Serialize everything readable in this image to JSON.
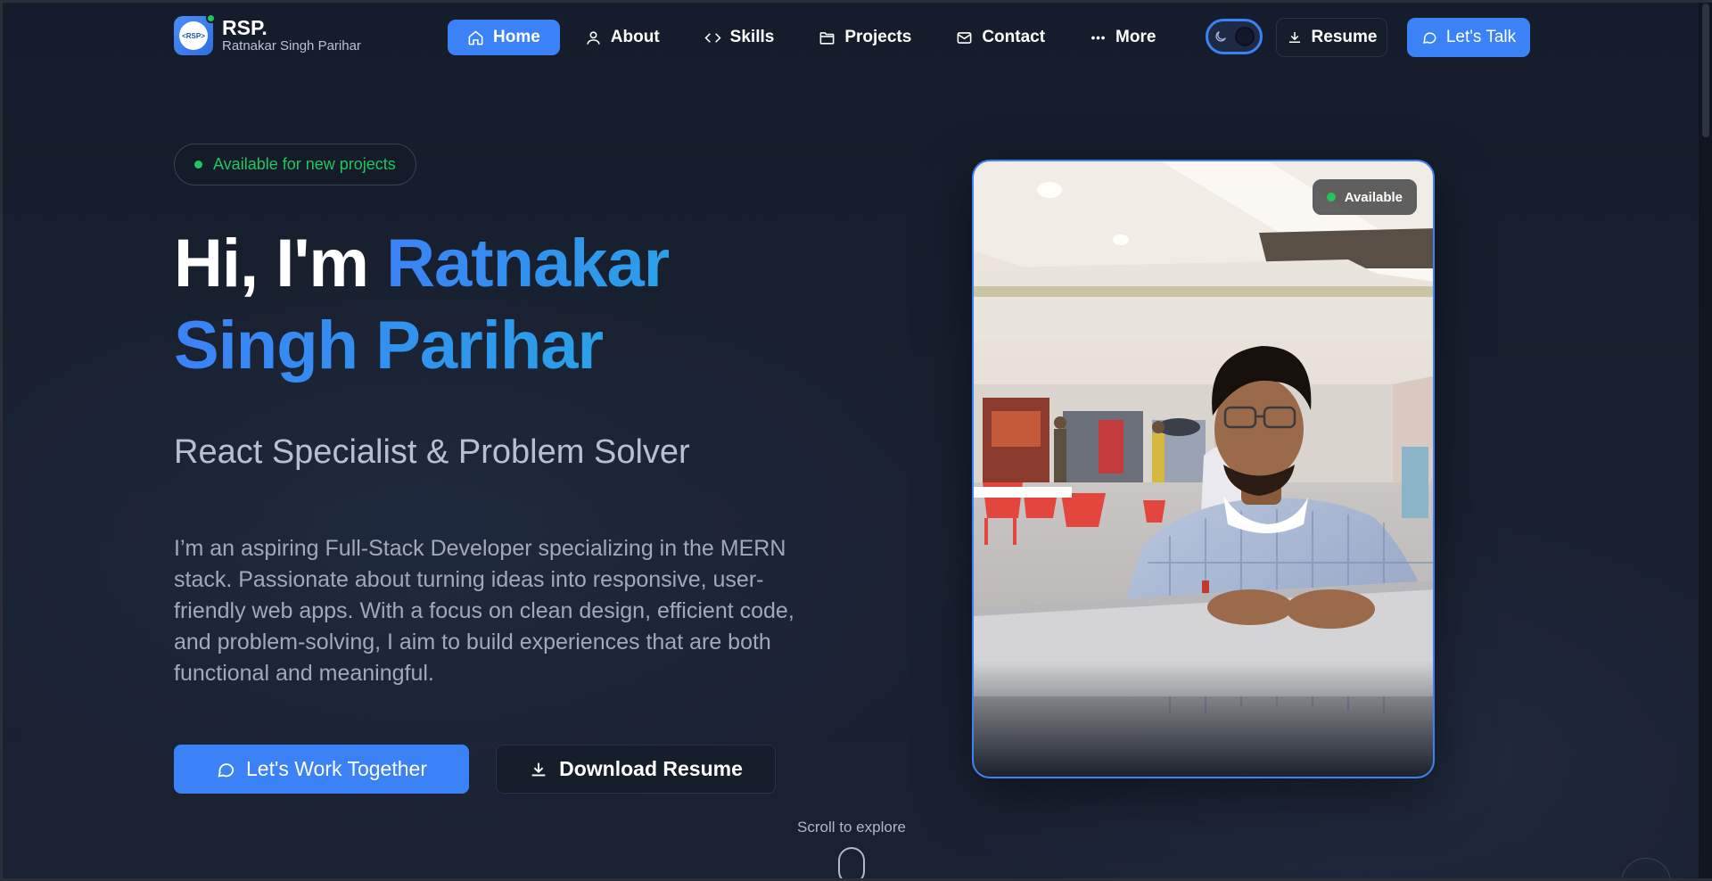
{
  "brand": {
    "logo_text": "<RSP>",
    "title": "RSP.",
    "subtitle": "Ratnakar Singh Parihar"
  },
  "nav": {
    "items": [
      {
        "label": "Home",
        "icon": "home-icon",
        "active": true
      },
      {
        "label": "About",
        "icon": "user-icon",
        "active": false
      },
      {
        "label": "Skills",
        "icon": "code-icon",
        "active": false
      },
      {
        "label": "Projects",
        "icon": "folder-icon",
        "active": false
      },
      {
        "label": "Contact",
        "icon": "mail-icon",
        "active": false
      },
      {
        "label": "More",
        "icon": "more-dots-icon",
        "active": false
      }
    ],
    "theme_toggle": {
      "icon": "moon-icon",
      "state": "dark"
    },
    "resume_label": "Resume",
    "talk_label": "Let's Talk"
  },
  "hero": {
    "availability": "Available for new projects",
    "greeting": "Hi, I'm ",
    "name_line1": "Ratnakar",
    "name_line2": "Singh Parihar",
    "tagline": "React Specialist & Problem Solver",
    "intro": "I’m an aspiring Full-Stack Developer specializing in the MERN stack. Passionate about turning ideas into responsive, user-friendly web apps. With a focus on clean design, efficient code, and problem-solving, I aim to build experiences that are both functional and meaningful.",
    "cta_primary": "Let's Work Together",
    "cta_secondary": "Download Resume",
    "scroll_hint": "Scroll to explore"
  },
  "photo_card": {
    "badge": "Available"
  },
  "colors": {
    "accent": "#3b82f6",
    "status": "#22c55e",
    "background": "#18202f"
  }
}
